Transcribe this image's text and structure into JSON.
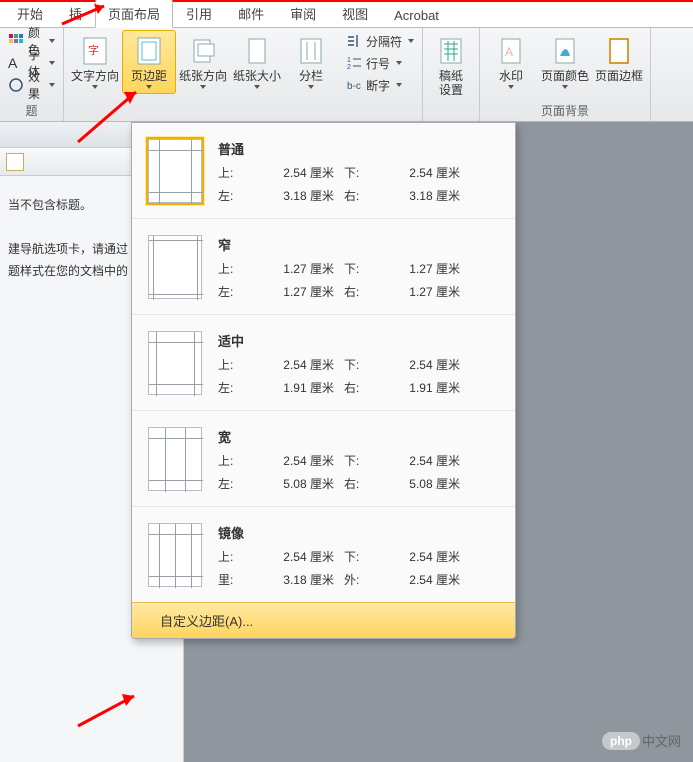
{
  "tabs": [
    "开始",
    "插",
    "页面布局",
    "引用",
    "邮件",
    "审阅",
    "视图",
    "Acrobat"
  ],
  "active_tab_index": 2,
  "ribbon": {
    "themes": {
      "color": "颜色",
      "font": "字体",
      "effect": "效果",
      "label": "题"
    },
    "text_direction": "文字方向",
    "margins": "页边距",
    "orientation": "纸张方向",
    "size": "纸张大小",
    "columns": "分栏",
    "breaks": "分隔符",
    "line_numbers": "行号",
    "hyphenation": "断字",
    "manuscript": "稿纸\n设置",
    "watermark": "水印",
    "page_color": "页面颜色",
    "page_border": "页面边框",
    "group_bg": "页面背景"
  },
  "navpane": {
    "no_title": "当不包含标题。",
    "hint1": "建导航选项卡，请通过",
    "hint2": "题样式在您的文档中的"
  },
  "presets": [
    {
      "name": "普通",
      "top_lbl": "上:",
      "top": "2.54 厘米",
      "bottom_lbl": "下:",
      "bottom": "2.54 厘米",
      "left_lbl": "左:",
      "left": "3.18 厘米",
      "right_lbl": "右:",
      "right": "3.18 厘米"
    },
    {
      "name": "窄",
      "top_lbl": "上:",
      "top": "1.27 厘米",
      "bottom_lbl": "下:",
      "bottom": "1.27 厘米",
      "left_lbl": "左:",
      "left": "1.27 厘米",
      "right_lbl": "右:",
      "right": "1.27 厘米"
    },
    {
      "name": "适中",
      "top_lbl": "上:",
      "top": "2.54 厘米",
      "bottom_lbl": "下:",
      "bottom": "2.54 厘米",
      "left_lbl": "左:",
      "left": "1.91 厘米",
      "right_lbl": "右:",
      "right": "1.91 厘米"
    },
    {
      "name": "宽",
      "top_lbl": "上:",
      "top": "2.54 厘米",
      "bottom_lbl": "下:",
      "bottom": "2.54 厘米",
      "left_lbl": "左:",
      "left": "5.08 厘米",
      "right_lbl": "右:",
      "right": "5.08 厘米"
    },
    {
      "name": "镜像",
      "top_lbl": "上:",
      "top": "2.54 厘米",
      "bottom_lbl": "下:",
      "bottom": "2.54 厘米",
      "left_lbl": "里:",
      "left": "3.18 厘米",
      "right_lbl": "外:",
      "right": "2.54 厘米"
    }
  ],
  "custom_label": "自定义边距(A)...",
  "watermark_site": "中文网",
  "watermark_badge": "php"
}
